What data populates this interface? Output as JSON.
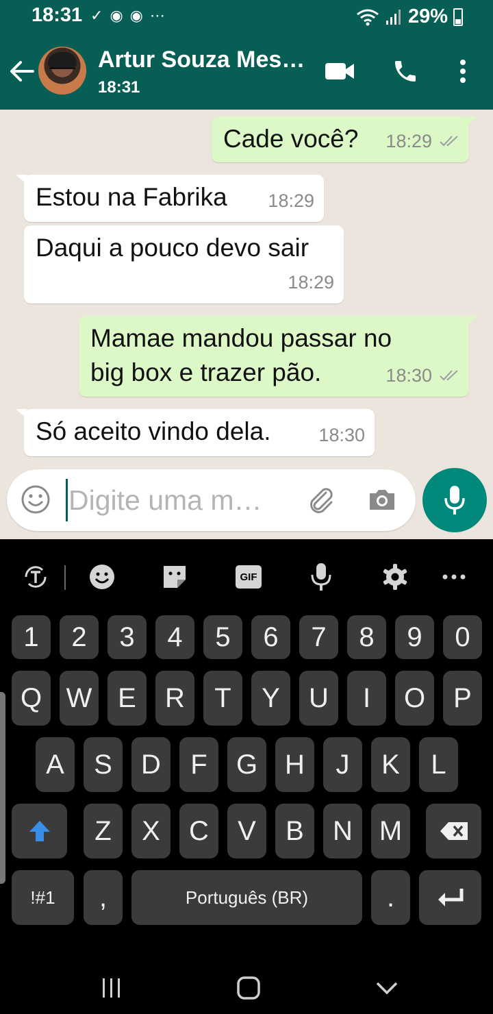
{
  "status_bar": {
    "time": "18:31",
    "battery": "29%"
  },
  "header": {
    "contact_name": "Artur Souza Mes…",
    "contact_status": "18:31"
  },
  "messages": [
    {
      "direction": "out",
      "text": "Cade você?",
      "time": "18:29",
      "read": true
    },
    {
      "direction": "in",
      "text": "Estou na Fabrika",
      "time": "18:29"
    },
    {
      "direction": "in",
      "text": "Daqui a pouco devo sair",
      "time": "18:29"
    },
    {
      "direction": "out",
      "text_line1": "Mamae mandou passar no",
      "text_line2": "big box e trazer pão.",
      "time": "18:30",
      "read": true
    },
    {
      "direction": "in",
      "text": "Só aceito vindo dela.",
      "time": "18:30"
    }
  ],
  "composer": {
    "placeholder": "Digite uma m…"
  },
  "keyboard": {
    "number_row": [
      "1",
      "2",
      "3",
      "4",
      "5",
      "6",
      "7",
      "8",
      "9",
      "0"
    ],
    "row1": [
      "Q",
      "W",
      "E",
      "R",
      "T",
      "Y",
      "U",
      "I",
      "O",
      "P"
    ],
    "row2": [
      "A",
      "S",
      "D",
      "F",
      "G",
      "H",
      "J",
      "K",
      "L"
    ],
    "row3": [
      "Z",
      "X",
      "C",
      "V",
      "B",
      "N",
      "M"
    ],
    "symbols_key": "!#1",
    "comma_key": ",",
    "space_label": "Português (BR)",
    "period_key": ".",
    "gif_label": "GIF"
  },
  "colors": {
    "header": "#075e54",
    "outgoing_bubble": "#dcf8c6",
    "incoming_bubble": "#ffffff",
    "accent": "#00897b",
    "read_tick": "#9e9e9e"
  }
}
